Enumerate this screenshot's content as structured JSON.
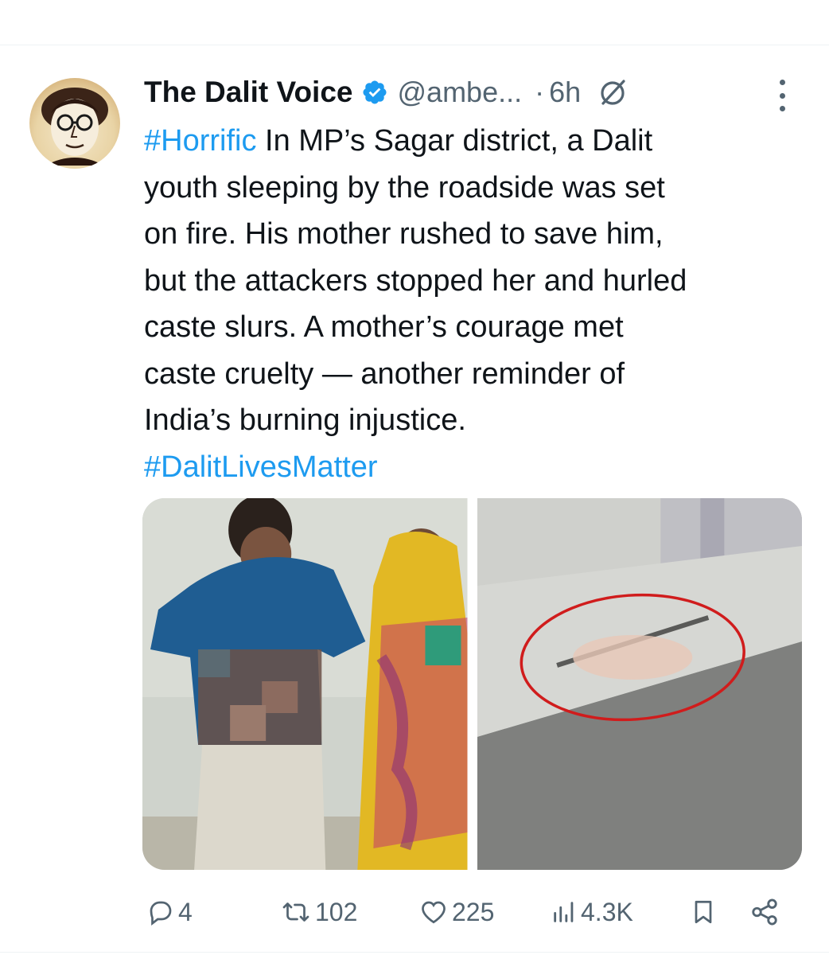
{
  "tweet": {
    "display_name": "The Dalit Voice",
    "handle": "@ambe...",
    "separator": "·",
    "time": "6h",
    "text_lines": [
      {
        "hashtag": "#Horrific",
        "text": " In MP’s Sagar district, a Dalit"
      },
      {
        "text": "youth sleeping by the roadside was set"
      },
      {
        "text": "on fire. His mother rushed to save him,"
      },
      {
        "text": "but the attackers stopped her and hurled"
      },
      {
        "text": "caste slurs. A mother’s courage met"
      },
      {
        "text": "caste cruelty — another reminder of"
      },
      {
        "text": "India’s burning injustice."
      },
      {
        "hashtag": "#DalitLivesMatter"
      }
    ]
  },
  "actions": {
    "replies": "4",
    "reposts": "102",
    "likes": "225",
    "views": "4.3K"
  },
  "colors": {
    "accent": "#1d9bf0",
    "text": "#0f1419",
    "secondary": "#536471"
  },
  "icons": {
    "verified": "verified-badge-icon",
    "grok": "grok-icon",
    "more": "more-options-icon",
    "reply": "reply-icon",
    "repost": "repost-icon",
    "like": "heart-icon",
    "views": "analytics-icon",
    "bookmark": "bookmark-icon",
    "share": "share-icon"
  }
}
